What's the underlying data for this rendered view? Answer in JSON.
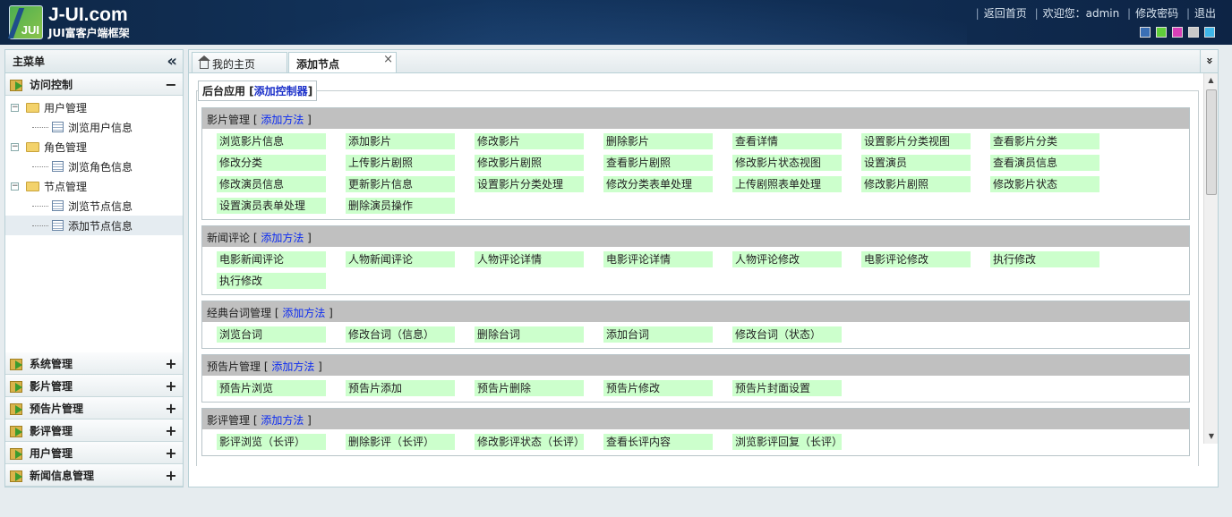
{
  "header": {
    "logo_text": "JUI",
    "title": "J-UI.com",
    "subtitle": "JUI富客户端框架",
    "links": [
      "返回首页",
      "欢迎您：admin",
      "修改密码",
      "退出"
    ],
    "themes": [
      "#3a6fb5",
      "#5fce3a",
      "#d83fb8",
      "#c9c9c9",
      "#3fb6e8"
    ]
  },
  "sidebar": {
    "title": "主菜单",
    "collapse_icon": "«",
    "open_section": {
      "label": "访问控制",
      "toggle": "−",
      "tree": [
        {
          "label": "用户管理",
          "children": [
            "浏览用户信息"
          ]
        },
        {
          "label": "角色管理",
          "children": [
            "浏览角色信息"
          ]
        },
        {
          "label": "节点管理",
          "children": [
            "浏览节点信息",
            "添加节点信息"
          ]
        }
      ]
    },
    "sections": [
      "系统管理",
      "影片管理",
      "预告片管理",
      "影评管理",
      "用户管理",
      "新闻信息管理"
    ],
    "expand_icon": "+"
  },
  "tabs": [
    {
      "label": "我的主页",
      "icon": "home-icon"
    },
    {
      "label": "添加节点",
      "close": "×"
    }
  ],
  "more_icon": "»",
  "content": {
    "legend_label": "后台应用 [",
    "legend_link": "添加控制器",
    "legend_end": "]",
    "add_method": "添加方法",
    "groups": [
      {
        "name": "影片管理",
        "items": [
          "浏览影片信息",
          "添加影片",
          "修改影片",
          "删除影片",
          "查看详情",
          "设置影片分类视图",
          "查看影片分类",
          "修改分类",
          "上传影片剧照",
          "修改影片剧照",
          "查看影片剧照",
          "修改影片状态视图",
          "设置演员",
          "查看演员信息",
          "修改演员信息",
          "更新影片信息",
          "设置影片分类处理",
          "修改分类表单处理",
          "上传剧照表单处理",
          "修改影片剧照",
          "修改影片状态",
          "设置演员表单处理",
          "删除演员操作"
        ]
      },
      {
        "name": "新闻评论",
        "items": [
          "电影新闻评论",
          "人物新闻评论",
          "人物评论详情",
          "电影评论详情",
          "人物评论修改",
          "电影评论修改",
          "执行修改",
          "执行修改"
        ]
      },
      {
        "name": "经典台词管理",
        "items": [
          "浏览台词",
          "修改台词（信息）",
          "删除台词",
          "添加台词",
          "修改台词（状态）"
        ]
      },
      {
        "name": "预告片管理",
        "items": [
          "预告片浏览",
          "预告片添加",
          "预告片删除",
          "预告片修改",
          "预告片封面设置"
        ]
      },
      {
        "name": "影评管理",
        "items": [
          "影评浏览（长评）",
          "删除影评（长评）",
          "修改影评状态（长评）",
          "查看长评内容",
          "浏览影评回复（长评）"
        ]
      }
    ]
  }
}
